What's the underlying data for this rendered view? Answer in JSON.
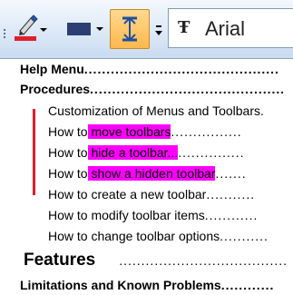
{
  "toolbar": {
    "font_name": "Arial",
    "font_color": "#e31d2a",
    "fill_color": "#2b3f73",
    "highlight_active_color": "#ffb84c",
    "icons": [
      "grip-icon",
      "font-color-icon",
      "fill-color-icon",
      "highlight-text-icon",
      "overflow-icon",
      "font-type-icon"
    ]
  },
  "document": {
    "lines": [
      {
        "id": "help-menu",
        "text": "Help Menu",
        "leader": "............................................"
      },
      {
        "id": "procedures",
        "text": "Procedures",
        "leader": "............................................"
      },
      {
        "id": "customization",
        "text": "Customization of Menus and Toolbars."
      },
      {
        "id": "move-toolbars",
        "prefix": "How to",
        "highlight": " move toolbars",
        "leader": "................"
      },
      {
        "id": "hide-toolbar",
        "prefix": "How to",
        "highlight": " hide a toolbar...",
        "leader": "..............."
      },
      {
        "id": "show-hidden",
        "prefix": "How to",
        "highlight": " show a hidden toolbar",
        "leader": "......."
      },
      {
        "id": "create-toolbar",
        "text": "How to create a new toolbar",
        "leader": "..........."
      },
      {
        "id": "modify-items",
        "text": "How to modify toolbar items",
        "leader": "............"
      },
      {
        "id": "change-options",
        "text": "How to change toolbar options",
        "leader": "..........."
      },
      {
        "id": "features",
        "text": "Features",
        "leader": "......................................"
      },
      {
        "id": "limitations",
        "text": "Limitations and Known Problems",
        "leader": "............"
      }
    ],
    "highlight_color": "#ff00ff",
    "change_bar_color": "#e31d2a"
  }
}
